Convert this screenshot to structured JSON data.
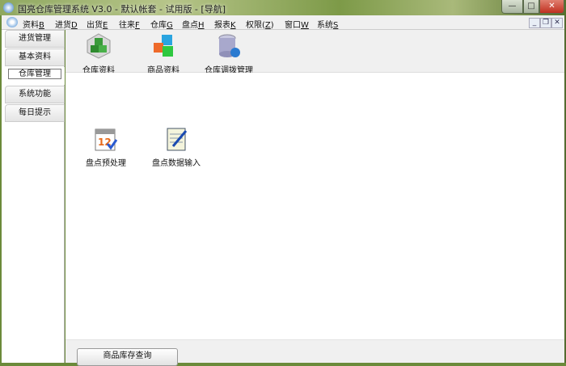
{
  "window": {
    "title": "国亮仓库管理系统 V3.0 - 默认帐套 - 试用版 - [导航]",
    "minimize": "—",
    "maximize": "□",
    "close": "✕"
  },
  "menu": [
    {
      "label": "资料",
      "key": "B"
    },
    {
      "label": "进货",
      "key": "D"
    },
    {
      "label": "出货",
      "key": "E"
    },
    {
      "label": "往来",
      "key": "F"
    },
    {
      "label": "仓库",
      "key": "G"
    },
    {
      "label": "盘点",
      "key": "H"
    },
    {
      "label": "报表",
      "key": "K"
    },
    {
      "label": "权限(",
      "key": "Z",
      "suffix": ")"
    },
    {
      "label": "窗口",
      "key": "W"
    },
    {
      "label": "系统",
      "key": "S"
    }
  ],
  "mdi": {
    "minimize": "_",
    "restore": "❐",
    "close": "✕"
  },
  "sidebar": {
    "tabs": [
      "进货管理",
      "基本资料",
      "仓库管理",
      "系统功能",
      "每日提示"
    ],
    "active": 2
  },
  "toolbar": {
    "items": [
      "仓库资料",
      "商品资料",
      "仓库调拨管理"
    ]
  },
  "main": {
    "items": [
      "盘点预处理",
      "盘点数据输入"
    ]
  },
  "bottom": {
    "button": "商品库存查询"
  }
}
